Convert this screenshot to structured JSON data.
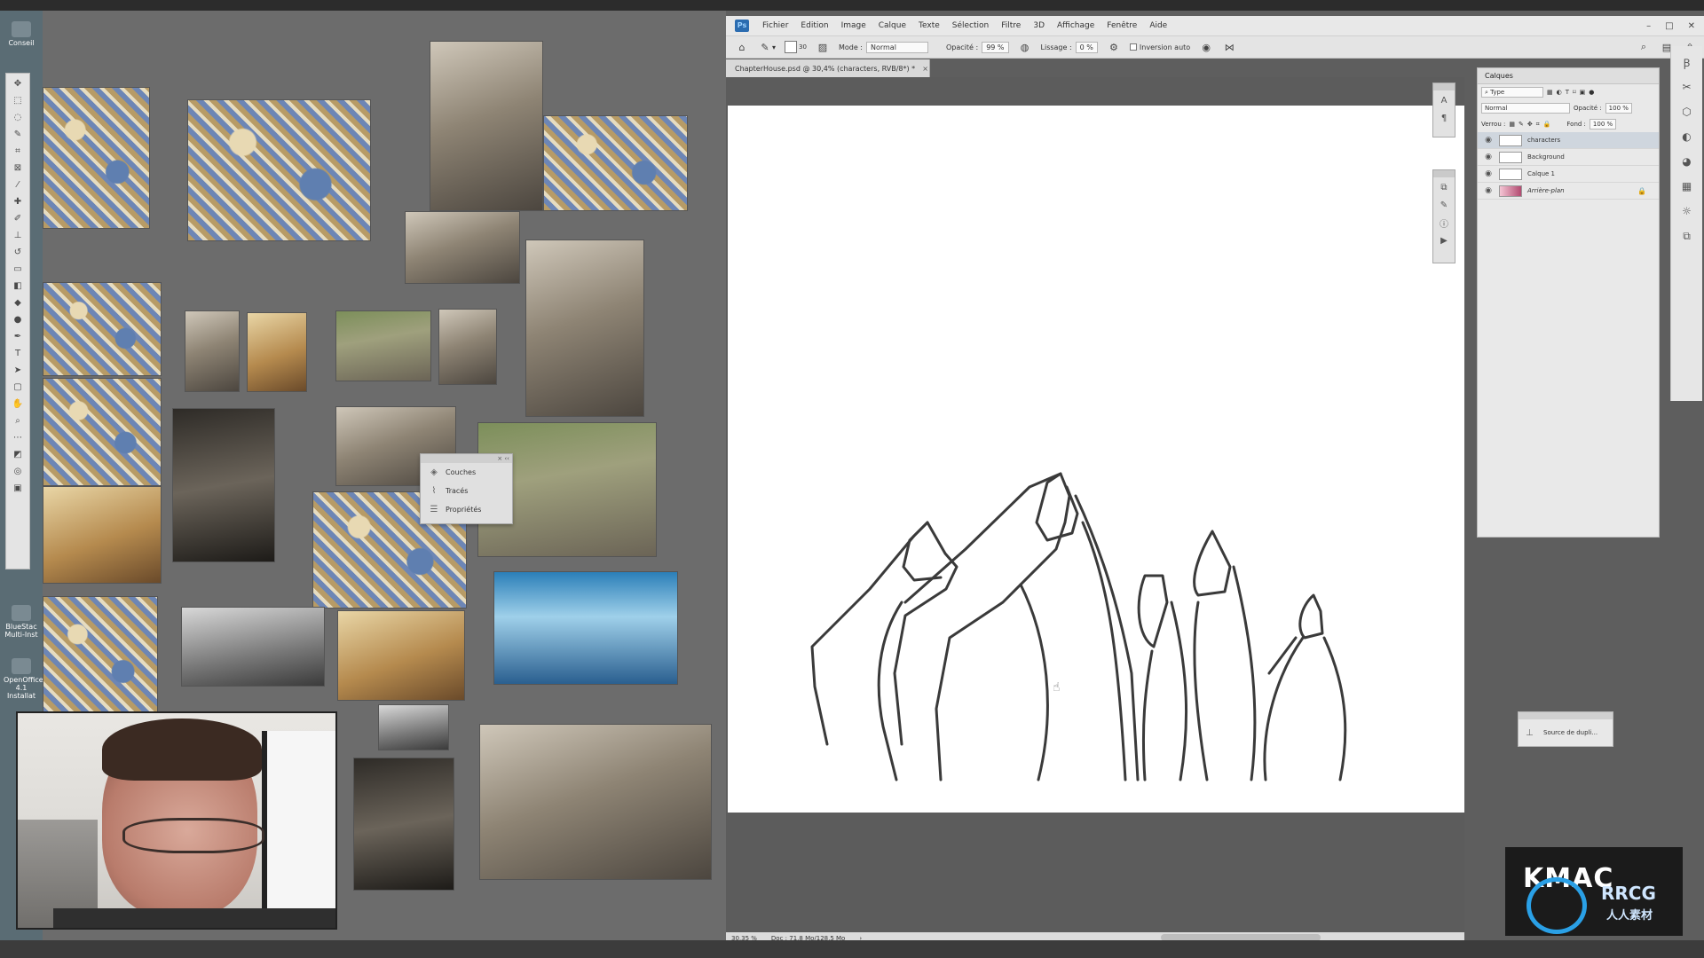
{
  "desktop": {
    "icons": [
      {
        "label": "Conseil"
      },
      {
        "label": "BlueStac Multi-Inst"
      },
      {
        "label": "OpenOffice 4.1 Installat"
      }
    ],
    "float_panel": {
      "items": [
        {
          "label": "Couches",
          "icon": "layers-icon"
        },
        {
          "label": "Tracés",
          "icon": "paths-icon"
        },
        {
          "label": "Propriétés",
          "icon": "properties-icon"
        }
      ]
    }
  },
  "photoshop": {
    "logo": "Ps",
    "menu": [
      "Fichier",
      "Edition",
      "Image",
      "Calque",
      "Texte",
      "Sélection",
      "Filtre",
      "3D",
      "Affichage",
      "Fenêtre",
      "Aide"
    ],
    "options": {
      "brush_size": "30",
      "mode_label": "Mode :",
      "mode_value": "Normal",
      "opacity_label": "Opacité :",
      "opacity_value": "99 %",
      "smoothing_label": "Lissage :",
      "smoothing_value": "0 %",
      "auto_erase_label": "Inversion auto"
    },
    "document_tab": {
      "title": "ChapterHouse.psd @ 30,4% (characters, RVB/8*) *",
      "close": "×"
    },
    "status": {
      "zoom": "30,35 %",
      "doc": "Doc : 71,8 Mo/128,5 Mo"
    },
    "layers_panel": {
      "tab": "Calques",
      "filter": "Type",
      "blend_mode": "Normal",
      "opacity_label": "Opacité :",
      "opacity_value": "100 %",
      "lock_label": "Verrou :",
      "fill_label": "Fond :",
      "fill_value": "100 %",
      "layers": [
        {
          "name": "characters",
          "selected": true
        },
        {
          "name": "Background",
          "selected": false
        },
        {
          "name": "Calque 1",
          "selected": false
        },
        {
          "name": "Arrière-plan",
          "selected": false,
          "locked": true
        }
      ]
    },
    "clone_source_panel": {
      "label": "Source de dupli..."
    }
  },
  "branding": {
    "logo_text": "KMAC",
    "watermark": "RRCG",
    "watermark_cn": "人人素材"
  },
  "colors": {
    "ps_chrome": "#e4e4e4",
    "canvas": "#ffffff",
    "selected_layer": "#cfd6de",
    "ps_logo": "#2b6cb0"
  }
}
